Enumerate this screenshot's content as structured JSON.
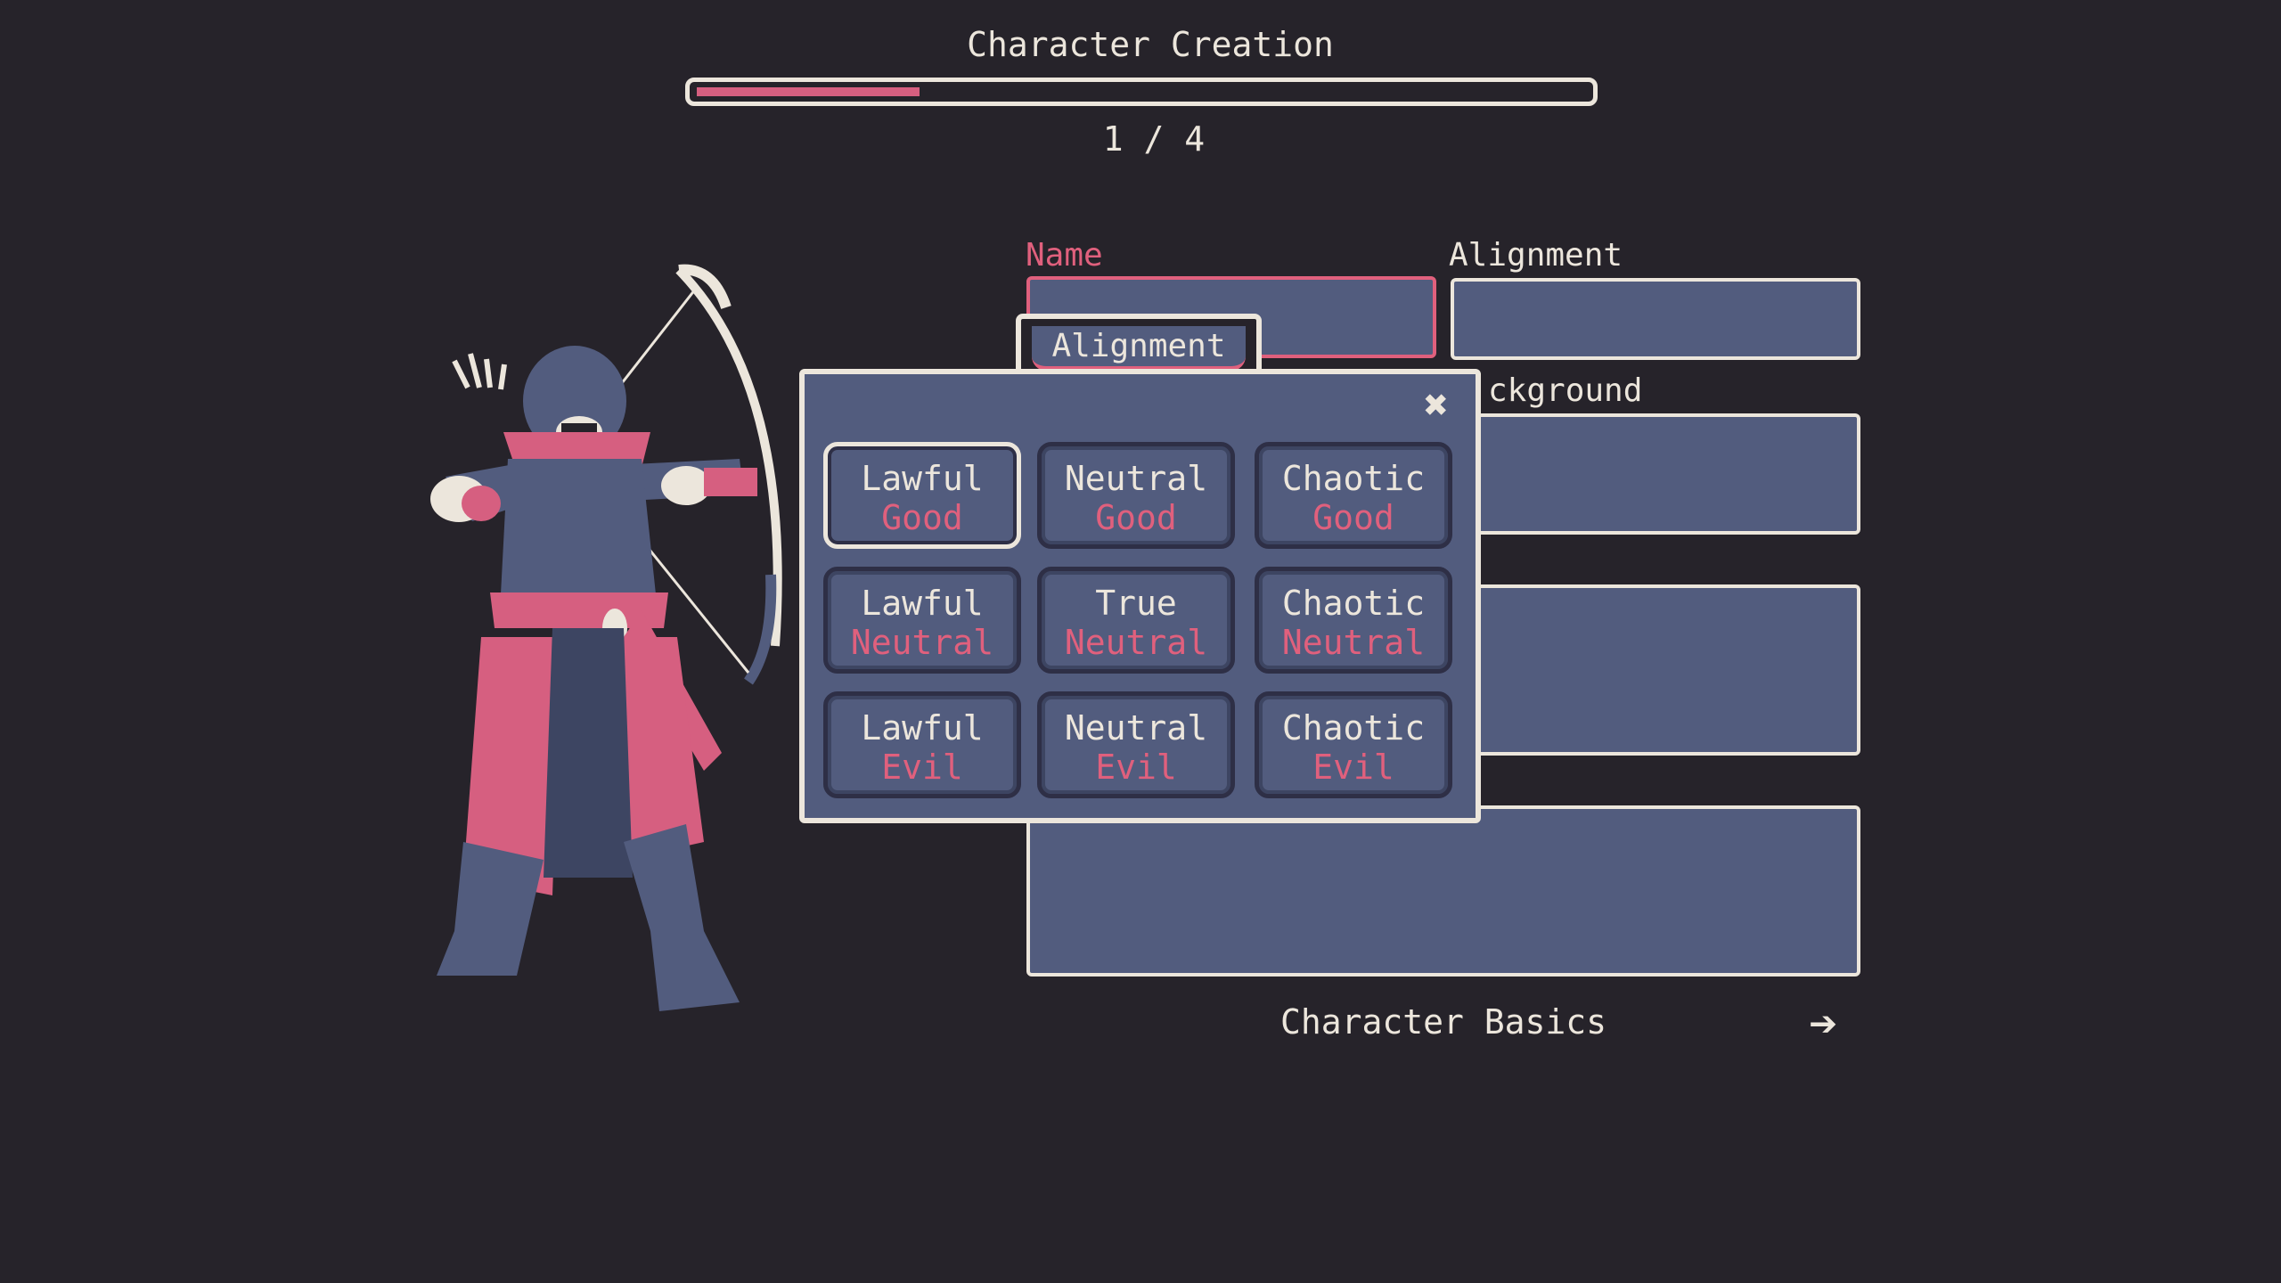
{
  "header": {
    "title": "Character Creation",
    "progress_text": "1 / 4",
    "progress": 0.25
  },
  "form": {
    "name_label": "Name",
    "alignment_label": "Alignment",
    "background_label_visible": "ckground"
  },
  "modal": {
    "tab_label": "Alignment",
    "options": [
      {
        "line1": "Lawful",
        "line2": "Good",
        "selected": true
      },
      {
        "line1": "Neutral",
        "line2": "Good"
      },
      {
        "line1": "Chaotic",
        "line2": "Good"
      },
      {
        "line1": "Lawful",
        "line2": "Neutral"
      },
      {
        "line1": "True",
        "line2": "Neutral"
      },
      {
        "line1": "Chaotic",
        "line2": "Neutral"
      },
      {
        "line1": "Lawful",
        "line2": "Evil"
      },
      {
        "line1": "Neutral",
        "line2": "Evil"
      },
      {
        "line1": "Chaotic",
        "line2": "Evil"
      }
    ]
  },
  "footer": {
    "section_label": "Character Basics",
    "next_icon": "arrow-right-icon"
  },
  "colors": {
    "background": "#26232a",
    "panel": "#525c7e",
    "accent": "#e0607d",
    "border": "#ece6dc"
  }
}
